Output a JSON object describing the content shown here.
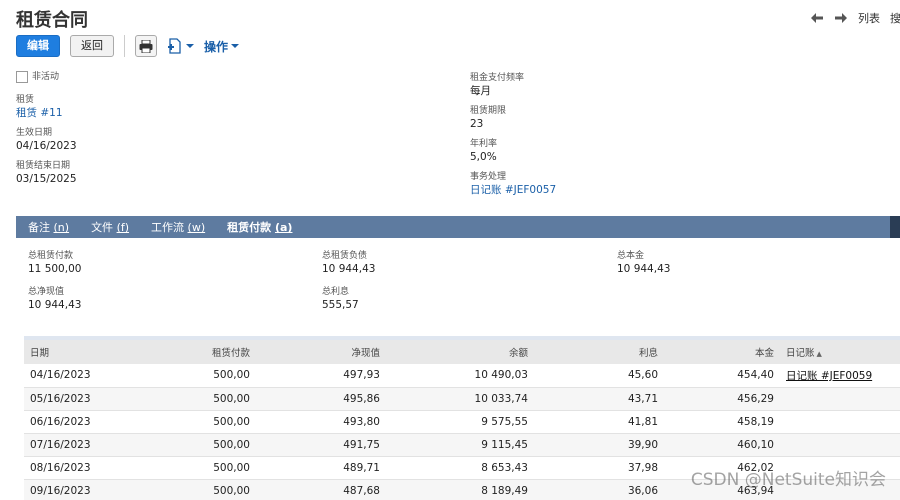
{
  "page": {
    "title": "租赁合同",
    "nav_list": "列表",
    "nav_search": "搜"
  },
  "toolbar": {
    "edit": "编辑",
    "back": "返回",
    "actions": "操作"
  },
  "fields_left": {
    "inactive_label": "非活动",
    "lease_label": "租赁",
    "lease_value": "租赁 #11",
    "effective_label": "生效日期",
    "effective_value": "04/16/2023",
    "end_label": "租赁结束日期",
    "end_value": "03/15/2025"
  },
  "fields_right": {
    "freq_label": "租金支付频率",
    "freq_value": "每月",
    "term_label": "租赁期限",
    "term_value": "23",
    "rate_label": "年利率",
    "rate_value": "5,0%",
    "txn_label": "事务处理",
    "txn_value": "日记账 #JEF0057"
  },
  "tabs": [
    {
      "label": "备注 ",
      "key": "(n)"
    },
    {
      "label": "文件 ",
      "key": "(f)"
    },
    {
      "label": "工作流 ",
      "key": "(w)"
    },
    {
      "label": "租赁付款 ",
      "key": "(a)"
    }
  ],
  "summary": {
    "total_payments_label": "总租赁付款",
    "total_payments_value": "11 500,00",
    "total_liability_label": "总租赁负债",
    "total_liability_value": "10 944,43",
    "total_principal_label": "总本金",
    "total_principal_value": "10 944,43",
    "total_npv_label": "总净现值",
    "total_npv_value": "10 944,43",
    "total_interest_label": "总利息",
    "total_interest_value": "555,57"
  },
  "table": {
    "headers": [
      "日期",
      "租赁付款",
      "净现值",
      "余额",
      "利息",
      "本金",
      "日记账"
    ],
    "rows": [
      [
        "04/16/2023",
        "500,00",
        "497,93",
        "10 490,03",
        "45,60",
        "454,40",
        "日记账 #JEF0059"
      ],
      [
        "05/16/2023",
        "500,00",
        "495,86",
        "10 033,74",
        "43,71",
        "456,29",
        ""
      ],
      [
        "06/16/2023",
        "500,00",
        "493,80",
        "9 575,55",
        "41,81",
        "458,19",
        ""
      ],
      [
        "07/16/2023",
        "500,00",
        "491,75",
        "9 115,45",
        "39,90",
        "460,10",
        ""
      ],
      [
        "08/16/2023",
        "500,00",
        "489,71",
        "8 653,43",
        "37,98",
        "462,02",
        ""
      ],
      [
        "09/16/2023",
        "500,00",
        "487,68",
        "8 189,49",
        "36,06",
        "463,94",
        ""
      ]
    ]
  },
  "watermark": "CSDN @NetSuite知识会",
  "colors": {
    "primary_button": "#1f7ee0",
    "tab_bar": "#5e7ba0",
    "link": "#1a5fa8"
  }
}
